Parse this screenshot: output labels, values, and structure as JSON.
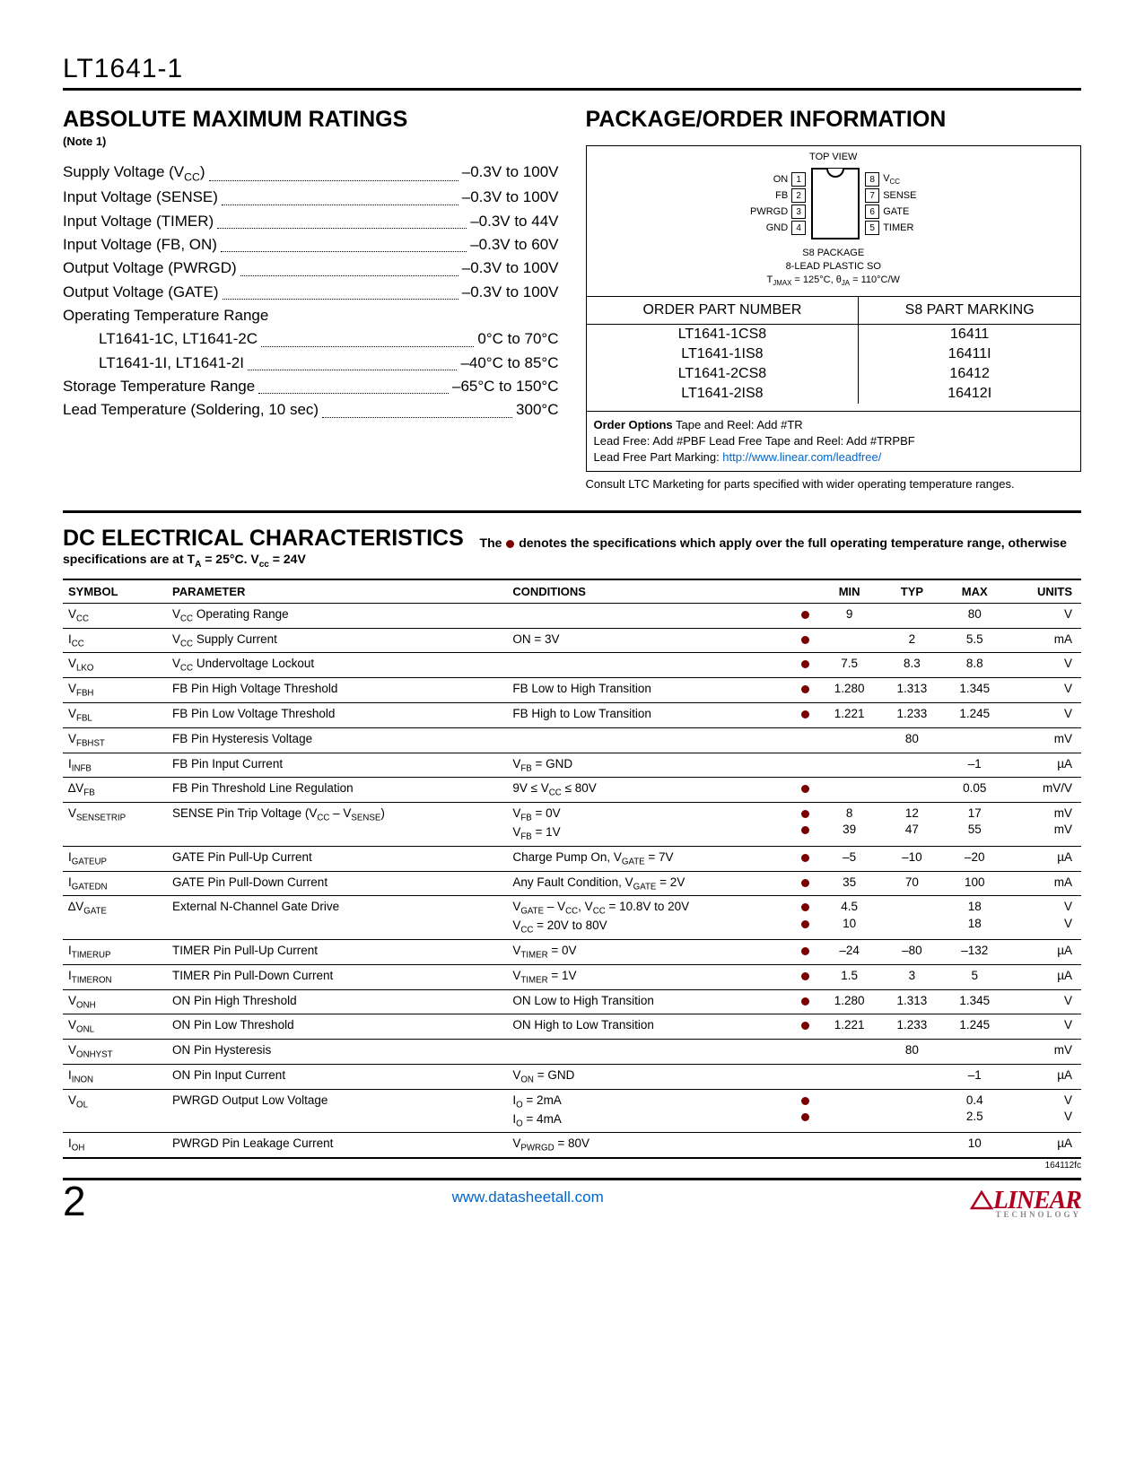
{
  "part_number": "LT1641-1",
  "sections": {
    "amr_title": "ABSOLUTE MAXIMUM RATINGS",
    "amr_note": "(Note 1)",
    "pkg_title": "PACKAGE/ORDER INFORMATION",
    "dc_title": "DC ELECTRICAL CHARACTERISTICS",
    "dc_desc_prefix": "The ",
    "dc_desc_suffix": " denotes the specifications which apply over the full operating temperature range, otherwise specifications are at T",
    "dc_desc_tail": " = 25°C. V",
    "dc_desc_end": " = 24V"
  },
  "ratings": [
    {
      "label": "Supply Voltage (V",
      "sub": "CC",
      "post": ")",
      "value": "–0.3V to 100V"
    },
    {
      "label": "Input Voltage (SENSE)",
      "value": "–0.3V to 100V"
    },
    {
      "label": "Input Voltage (TIMER)",
      "value": "–0.3V to 44V"
    },
    {
      "label": "Input Voltage (FB, ON)",
      "value": "–0.3V to 60V"
    },
    {
      "label": "Output Voltage (PWRGD)",
      "value": "–0.3V to 100V"
    },
    {
      "label": "Output Voltage (GATE)",
      "value": "–0.3V to 100V"
    },
    {
      "label": "Operating Temperature Range",
      "value": ""
    },
    {
      "label": "LT1641-1C, LT1641-2C",
      "indent": true,
      "value": "0°C to 70°C"
    },
    {
      "label": "LT1641-1I, LT1641-2I",
      "indent": true,
      "value": "–40°C to 85°C"
    },
    {
      "label": "Storage Temperature Range",
      "value": "–65°C to 150°C"
    },
    {
      "label": "Lead Temperature (Soldering, 10 sec)",
      "value": "300°C"
    }
  ],
  "package": {
    "topview": "TOP VIEW",
    "pins_left": [
      {
        "name": "ON",
        "num": "1"
      },
      {
        "name": "FB",
        "num": "2"
      },
      {
        "name": "PWRGD",
        "num": "3"
      },
      {
        "name": "GND",
        "num": "4"
      }
    ],
    "pins_right": [
      {
        "num": "8",
        "name": "V",
        "sub": "CC"
      },
      {
        "num": "7",
        "name": "SENSE"
      },
      {
        "num": "6",
        "name": "GATE"
      },
      {
        "num": "5",
        "name": "TIMER"
      }
    ],
    "caption1": "S8 PACKAGE",
    "caption2": "8-LEAD PLASTIC SO",
    "caption3_pre": "T",
    "caption3_sub1": "JMAX",
    "caption3_mid": " = 125°C, θ",
    "caption3_sub2": "JA",
    "caption3_end": " = 110°C/W",
    "header1": "ORDER PART NUMBER",
    "header2": "S8 PART MARKING",
    "rows": [
      {
        "part": "LT1641-1CS8",
        "mark": "16411"
      },
      {
        "part": "LT1641-1IS8",
        "mark": "16411I"
      },
      {
        "part": "LT1641-2CS8",
        "mark": "16412"
      },
      {
        "part": "LT1641-2IS8",
        "mark": "16412I"
      }
    ],
    "opts_bold": "Order Options",
    "opts1": "  Tape and Reel: Add #TR",
    "opts2": "Lead Free: Add #PBF   Lead Free Tape and Reel: Add #TRPBF",
    "opts3": "Lead Free Part Marking: ",
    "opts_link": "http://www.linear.com/leadfree/",
    "consult": "Consult LTC Marketing for parts specified with wider operating temperature ranges."
  },
  "dc_headers": [
    "SYMBOL",
    "PARAMETER",
    "CONDITIONS",
    "",
    "MIN",
    "TYP",
    "MAX",
    "UNITS"
  ],
  "dc_rows": [
    {
      "sym": "V<sub>CC</sub>",
      "param": "V<sub>CC</sub> Operating Range",
      "cond": "",
      "dot": "●",
      "min": "9",
      "typ": "",
      "max": "80",
      "unit": "V"
    },
    {
      "sym": "I<sub>CC</sub>",
      "param": "V<sub>CC</sub> Supply Current",
      "cond": "ON = 3V",
      "dot": "●",
      "min": "",
      "typ": "2",
      "max": "5.5",
      "unit": "mA"
    },
    {
      "sym": "V<sub>LKO</sub>",
      "param": "V<sub>CC</sub> Undervoltage Lockout",
      "cond": "",
      "dot": "●",
      "min": "7.5",
      "typ": "8.3",
      "max": "8.8",
      "unit": "V"
    },
    {
      "sym": "V<sub>FBH</sub>",
      "param": "FB Pin High Voltage Threshold",
      "cond": "FB Low to High Transition",
      "dot": "●",
      "min": "1.280",
      "typ": "1.313",
      "max": "1.345",
      "unit": "V"
    },
    {
      "sym": "V<sub>FBL</sub>",
      "param": "FB Pin Low Voltage Threshold",
      "cond": "FB High to Low Transition",
      "dot": "●",
      "min": "1.221",
      "typ": "1.233",
      "max": "1.245",
      "unit": "V"
    },
    {
      "sym": "V<sub>FBHST</sub>",
      "param": "FB Pin Hysteresis Voltage",
      "cond": "",
      "dot": "",
      "min": "",
      "typ": "80",
      "max": "",
      "unit": "mV"
    },
    {
      "sym": "I<sub>INFB</sub>",
      "param": "FB Pin Input Current",
      "cond": "V<sub>FB</sub> = GND",
      "dot": "",
      "min": "",
      "typ": "",
      "max": "–1",
      "unit": "µA"
    },
    {
      "sym": "∆V<sub>FB</sub>",
      "param": "FB Pin Threshold Line Regulation",
      "cond": "9V ≤ V<sub>CC</sub> ≤ 80V",
      "dot": "●",
      "min": "",
      "typ": "",
      "max": "0.05",
      "unit": "mV/V"
    },
    {
      "sym": "V<sub>SENSETRIP</sub>",
      "param": "SENSE Pin Trip Voltage (V<sub>CC</sub> – V<sub>SENSE</sub>)",
      "cond": "V<sub>FB</sub> = 0V<br>V<sub>FB</sub> = 1V",
      "dot": "●<br>●",
      "min": "8<br>39",
      "typ": "12<br>47",
      "max": "17<br>55",
      "unit": "mV<br>mV"
    },
    {
      "sym": "I<sub>GATEUP</sub>",
      "param": "GATE Pin Pull-Up Current",
      "cond": "Charge Pump On, V<sub>GATE</sub> = 7V",
      "dot": "●",
      "min": "–5",
      "typ": "–10",
      "max": "–20",
      "unit": "µA"
    },
    {
      "sym": "I<sub>GATEDN</sub>",
      "param": "GATE Pin Pull-Down Current",
      "cond": "Any Fault Condition, V<sub>GATE</sub> = 2V",
      "dot": "●",
      "min": "35",
      "typ": "70",
      "max": "100",
      "unit": "mA"
    },
    {
      "sym": "∆V<sub>GATE</sub>",
      "param": "External N-Channel Gate Drive",
      "cond": "V<sub>GATE</sub> – V<sub>CC</sub>, V<sub>CC</sub> = 10.8V to 20V<br>V<sub>CC</sub> = 20V to 80V",
      "dot": "●<br>●",
      "min": "4.5<br>10",
      "typ": "",
      "max": "18<br>18",
      "unit": "V<br>V"
    },
    {
      "sym": "I<sub>TIMERUP</sub>",
      "param": "TIMER Pin Pull-Up Current",
      "cond": "V<sub>TIMER</sub> = 0V",
      "dot": "●",
      "min": "–24",
      "typ": "–80",
      "max": "–132",
      "unit": "µA"
    },
    {
      "sym": "I<sub>TIMERON</sub>",
      "param": "TIMER Pin Pull-Down Current",
      "cond": "V<sub>TIMER</sub> = 1V",
      "dot": "●",
      "min": "1.5",
      "typ": "3",
      "max": "5",
      "unit": "µA"
    },
    {
      "sym": "V<sub>ONH</sub>",
      "param": "ON Pin High Threshold",
      "cond": "ON Low to High Transition",
      "dot": "●",
      "min": "1.280",
      "typ": "1.313",
      "max": "1.345",
      "unit": "V"
    },
    {
      "sym": "V<sub>ONL</sub>",
      "param": "ON Pin Low Threshold",
      "cond": "ON High to Low Transition",
      "dot": "●",
      "min": "1.221",
      "typ": "1.233",
      "max": "1.245",
      "unit": "V"
    },
    {
      "sym": "V<sub>ONHYST</sub>",
      "param": "ON Pin Hysteresis",
      "cond": "",
      "dot": "",
      "min": "",
      "typ": "80",
      "max": "",
      "unit": "mV"
    },
    {
      "sym": "I<sub>INON</sub>",
      "param": "ON Pin Input Current",
      "cond": "V<sub>ON</sub> = GND",
      "dot": "",
      "min": "",
      "typ": "",
      "max": "–1",
      "unit": "µA"
    },
    {
      "sym": "V<sub>OL</sub>",
      "param": "PWRGD Output Low Voltage",
      "cond": "I<sub>O</sub> = 2mA<br>I<sub>O</sub> = 4mA",
      "dot": "●<br>●",
      "min": "",
      "typ": "",
      "max": "0.4<br>2.5",
      "unit": "V<br>V"
    },
    {
      "sym": "I<sub>OH</sub>",
      "param": "PWRGD Pin Leakage Current",
      "cond": "V<sub>PWRGD</sub> = 80V",
      "dot": "",
      "min": "",
      "typ": "",
      "max": "10",
      "unit": "µA"
    }
  ],
  "doccode": "164112fc",
  "page_num": "2",
  "footer_link": "www.datasheetall.com",
  "logo_text": "LINEAR",
  "logo_sub": "TECHNOLOGY"
}
